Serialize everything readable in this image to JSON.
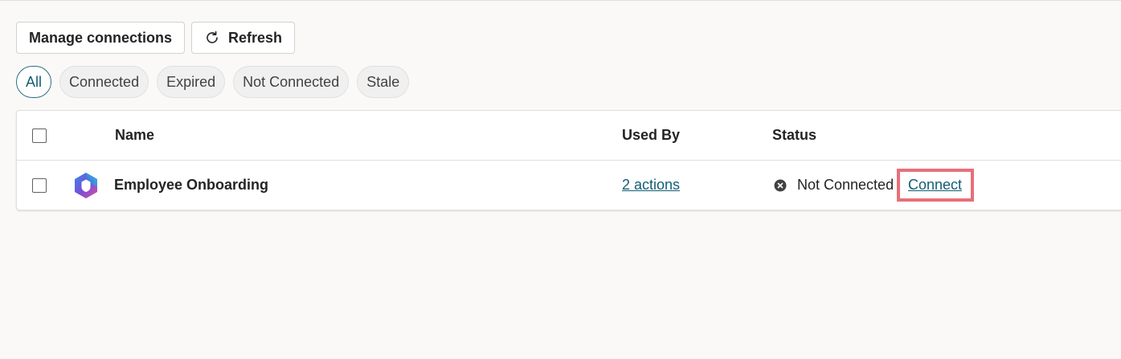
{
  "toolbar": {
    "manage_label": "Manage connections",
    "refresh_label": "Refresh",
    "refresh_icon": "refresh-icon"
  },
  "filters": [
    {
      "label": "All",
      "active": true
    },
    {
      "label": "Connected",
      "active": false
    },
    {
      "label": "Expired",
      "active": false
    },
    {
      "label": "Not Connected",
      "active": false
    },
    {
      "label": "Stale",
      "active": false
    }
  ],
  "table": {
    "columns": {
      "name": "Name",
      "used_by": "Used By",
      "status": "Status"
    },
    "rows": [
      {
        "icon": "microsoft-365-copilot-logo",
        "name": "Employee Onboarding",
        "used_by": "2 actions",
        "status": "Not Connected",
        "status_icon": "dismiss-circle-icon",
        "action": "Connect"
      }
    ]
  },
  "colors": {
    "accent": "#115e75",
    "highlight": "#e86f7a",
    "background": "#faf9f8"
  }
}
